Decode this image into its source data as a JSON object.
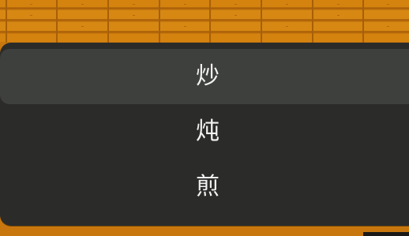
{
  "menu": {
    "items": [
      {
        "label": "炒",
        "selected": true
      },
      {
        "label": "炖",
        "selected": false
      },
      {
        "label": "煎",
        "selected": false
      }
    ]
  },
  "colors": {
    "wood": "#c8770e",
    "wood_light": "#d98a19",
    "wood_line": "#a85f08",
    "panel": "#2b2c2a",
    "panel_selected": "#3e403d",
    "text": "#f2f2f2"
  }
}
